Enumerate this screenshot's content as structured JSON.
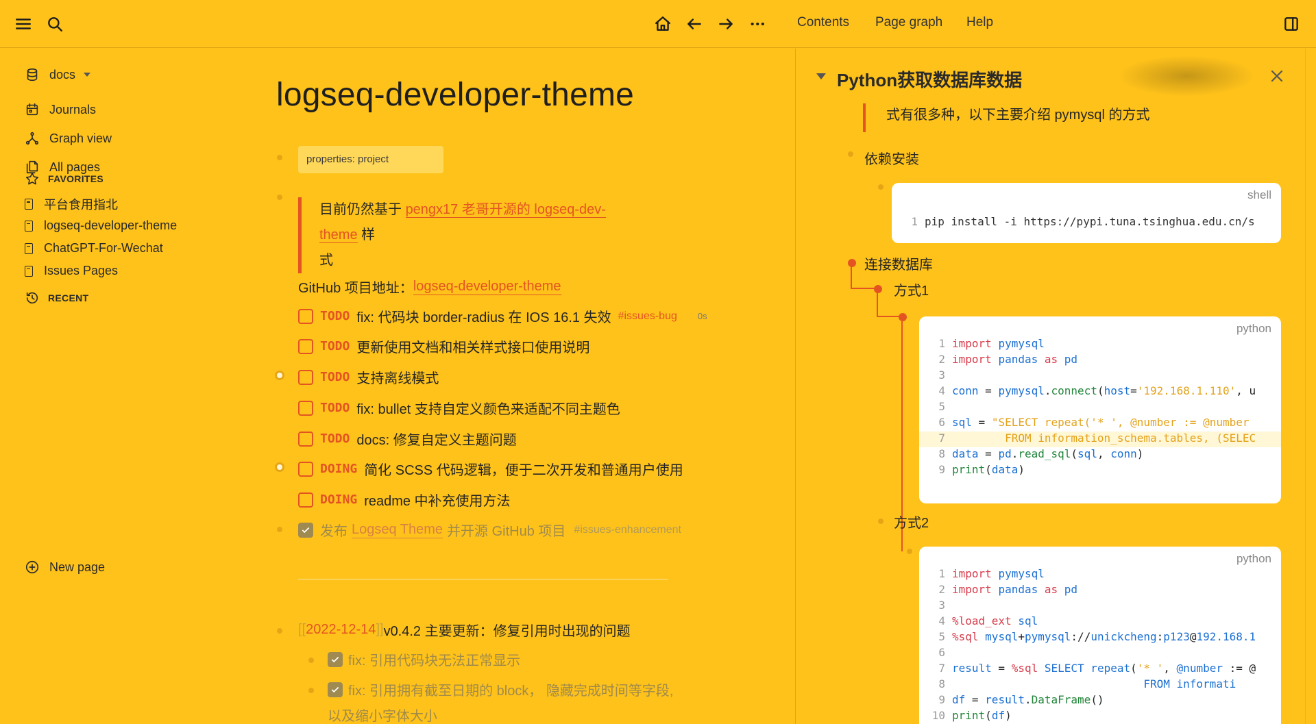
{
  "header": {
    "menu_icon": "menu-icon",
    "search_icon": "search-icon",
    "home_icon": "home-icon",
    "back_icon": "arrow-left-icon",
    "forward_icon": "arrow-right-icon",
    "more_icon": "more-icon",
    "links": [
      "Contents",
      "Page graph",
      "Help"
    ],
    "sidebar_toggle_icon": "sidebar-toggle-icon"
  },
  "sidebar": {
    "graph_name": "docs",
    "nav": [
      "Journals",
      "Graph view",
      "All pages"
    ],
    "favorites_label": "FAVORITES",
    "favorites": [
      "平台食用指北",
      "logseq-developer-theme",
      "ChatGPT-For-Wechat",
      "Issues Pages"
    ],
    "recent_label": "RECENT",
    "new_page": "New page"
  },
  "page": {
    "title": "logseq-developer-theme",
    "properties": "properties: project",
    "quote_prefix": "目前仍然基于 ",
    "quote_link": "pengx17 老哥开源的 logseq-dev-theme",
    "quote_suffix": " 样",
    "quote_line2": "式",
    "github_label": "GitHub 项目地址：",
    "github_link": "logseq-developer-theme",
    "tasks": [
      {
        "marker": "TODO",
        "text": "fix: 代码块 border-radius 在 IOS 16.1 失效",
        "tag": "#issues-bug",
        "time": "0s"
      },
      {
        "marker": "TODO",
        "text": "更新使用文档和相关样式接口使用说明"
      },
      {
        "marker": "TODO",
        "text": "支持离线模式"
      },
      {
        "marker": "TODO",
        "text": "fix: bullet 支持自定义颜色来适配不同主题色"
      },
      {
        "marker": "TODO",
        "text": "docs: 修复自定义主题问题"
      },
      {
        "marker": "DOING",
        "text": "简化 SCSS 代码逻辑，便于二次开发和普通用户使用"
      },
      {
        "marker": "DOING",
        "text": "readme 中补充使用方法"
      }
    ],
    "done_task": {
      "prefix": "发布 ",
      "link": "Logseq Theme",
      "suffix": " 并开源 GitHub 项目",
      "tag": "#issues-enhancement"
    },
    "journal_open": "[[",
    "journal_date": "2022-12-14",
    "journal_close": "]]",
    "journal_text": " v0.4.2 主要更新：修复引用时出现的问题",
    "sub_items": [
      "fix: 引用代码块无法正常显示",
      "fix: 引用拥有截至日期的 block， 隐藏完成时间等字段,"
    ],
    "sub_item_line2": "以及缩小字体大小"
  },
  "right_panel": {
    "title": "Python获取数据库数据",
    "cut_text": "式有很多种，以下主要介绍 pymysql 的方式",
    "deps_heading": "依赖安装",
    "shell_lang": "shell",
    "shell_line": "pip install -i https://pypi.tuna.tsinghua.edu.cn/s",
    "connect_heading": "连接数据库",
    "method1": "方式1",
    "method2": "方式2",
    "code1_lang": "python",
    "code2_lang": "python"
  }
}
